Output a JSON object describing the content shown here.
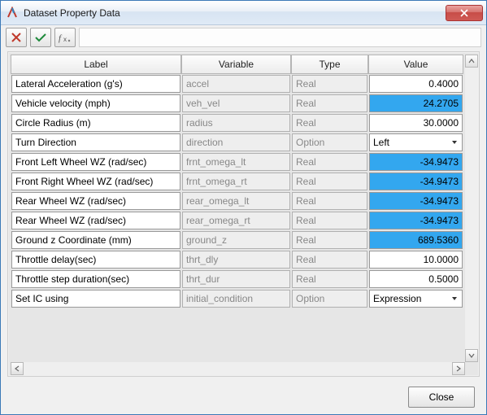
{
  "window": {
    "title": "Dataset Property Data"
  },
  "toolbar": {
    "cancel_icon": "cancel",
    "accept_icon": "accept",
    "fx_icon": "fx"
  },
  "columns": {
    "label": "Label",
    "variable": "Variable",
    "type": "Type",
    "value": "Value"
  },
  "rows": [
    {
      "label": "Lateral Acceleration (g's)",
      "variable": "accel",
      "type": "Real",
      "kind": "num",
      "value": "0.4000",
      "highlight": false
    },
    {
      "label": "Vehicle velocity (mph)",
      "variable": "veh_vel",
      "type": "Real",
      "kind": "num",
      "value": "24.2705",
      "highlight": true
    },
    {
      "label": "Circle Radius (m)",
      "variable": "radius",
      "type": "Real",
      "kind": "num",
      "value": "30.0000",
      "highlight": false
    },
    {
      "label": "Turn Direction",
      "variable": "direction",
      "type": "Option",
      "kind": "select",
      "value": "Left",
      "highlight": false
    },
    {
      "label": "Front Left Wheel WZ (rad/sec)",
      "variable": "frnt_omega_lt",
      "type": "Real",
      "kind": "num",
      "value": "-34.9473",
      "highlight": true
    },
    {
      "label": "Front Right Wheel WZ (rad/sec)",
      "variable": "frnt_omega_rt",
      "type": "Real",
      "kind": "num",
      "value": "-34.9473",
      "highlight": true
    },
    {
      "label": "Rear Wheel WZ (rad/sec)",
      "variable": "rear_omega_lt",
      "type": "Real",
      "kind": "num",
      "value": "-34.9473",
      "highlight": true
    },
    {
      "label": "Rear Wheel WZ (rad/sec)",
      "variable": "rear_omega_rt",
      "type": "Real",
      "kind": "num",
      "value": "-34.9473",
      "highlight": true
    },
    {
      "label": "Ground z Coordinate (mm)",
      "variable": "ground_z",
      "type": "Real",
      "kind": "num",
      "value": "689.5360",
      "highlight": true
    },
    {
      "label": "Throttle delay(sec)",
      "variable": "thrt_dly",
      "type": "Real",
      "kind": "num",
      "value": "10.0000",
      "highlight": false
    },
    {
      "label": "Throttle step duration(sec)",
      "variable": "thrt_dur",
      "type": "Real",
      "kind": "num",
      "value": "0.5000",
      "highlight": false
    },
    {
      "label": "Set IC using",
      "variable": "initial_condition",
      "type": "Option",
      "kind": "select",
      "value": "Expression",
      "highlight": false
    }
  ],
  "footer": {
    "close_label": "Close"
  },
  "colors": {
    "highlight": "#33a7ef"
  }
}
